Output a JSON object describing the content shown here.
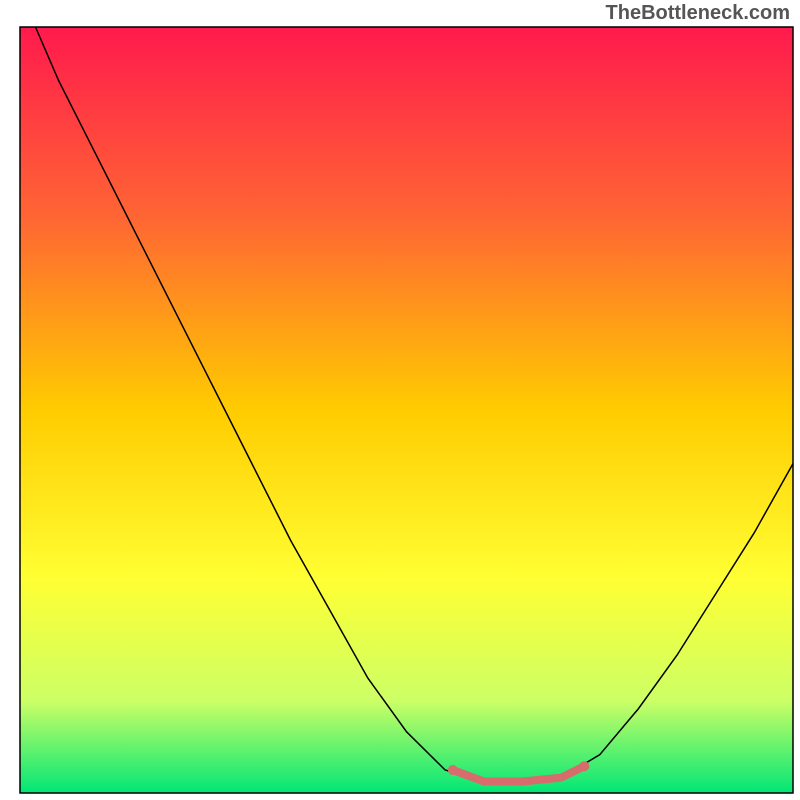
{
  "watermark": "TheBottleneck.com",
  "chart_data": {
    "type": "line",
    "title": "",
    "xlabel": "",
    "ylabel": "",
    "xlim": [
      0,
      100
    ],
    "ylim": [
      0,
      100
    ],
    "background_gradient": {
      "type": "vertical",
      "stops": [
        {
          "offset": 0,
          "color": "#ff1a4d"
        },
        {
          "offset": 0.25,
          "color": "#ff6633"
        },
        {
          "offset": 0.5,
          "color": "#ffcc00"
        },
        {
          "offset": 0.72,
          "color": "#ffff33"
        },
        {
          "offset": 0.88,
          "color": "#ccff66"
        },
        {
          "offset": 1.0,
          "color": "#00e676"
        }
      ]
    },
    "frame": {
      "color": "#000000",
      "width": 1.5
    },
    "series": [
      {
        "name": "bottleneck-curve",
        "type": "line",
        "color": "#000000",
        "stroke_width": 1.5,
        "points": [
          {
            "x": 2,
            "y": 100
          },
          {
            "x": 5,
            "y": 93
          },
          {
            "x": 10,
            "y": 83
          },
          {
            "x": 15,
            "y": 73
          },
          {
            "x": 20,
            "y": 63
          },
          {
            "x": 25,
            "y": 53
          },
          {
            "x": 30,
            "y": 43
          },
          {
            "x": 35,
            "y": 33
          },
          {
            "x": 40,
            "y": 24
          },
          {
            "x": 45,
            "y": 15
          },
          {
            "x": 50,
            "y": 8
          },
          {
            "x": 55,
            "y": 3
          },
          {
            "x": 60,
            "y": 1.5
          },
          {
            "x": 65,
            "y": 1.5
          },
          {
            "x": 70,
            "y": 2
          },
          {
            "x": 75,
            "y": 5
          },
          {
            "x": 80,
            "y": 11
          },
          {
            "x": 85,
            "y": 18
          },
          {
            "x": 90,
            "y": 26
          },
          {
            "x": 95,
            "y": 34
          },
          {
            "x": 100,
            "y": 43
          }
        ]
      },
      {
        "name": "highlight-segment",
        "type": "line",
        "color": "#d86b6b",
        "stroke_width": 8,
        "points": [
          {
            "x": 56,
            "y": 3
          },
          {
            "x": 60,
            "y": 1.5
          },
          {
            "x": 65,
            "y": 1.5
          },
          {
            "x": 70,
            "y": 2
          },
          {
            "x": 73,
            "y": 3.5
          }
        ]
      }
    ],
    "markers": [
      {
        "x": 56,
        "y": 3,
        "color": "#d86b6b",
        "size": 10
      },
      {
        "x": 73,
        "y": 3.5,
        "color": "#d86b6b",
        "size": 10
      }
    ]
  }
}
